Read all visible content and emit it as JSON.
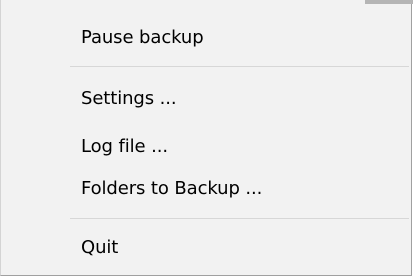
{
  "menu": {
    "items": [
      {
        "label": "Pause backup"
      },
      {
        "label": "Settings ..."
      },
      {
        "label": "Log file ..."
      },
      {
        "label": "Folders to Backup ..."
      },
      {
        "label": "Quit"
      }
    ]
  }
}
